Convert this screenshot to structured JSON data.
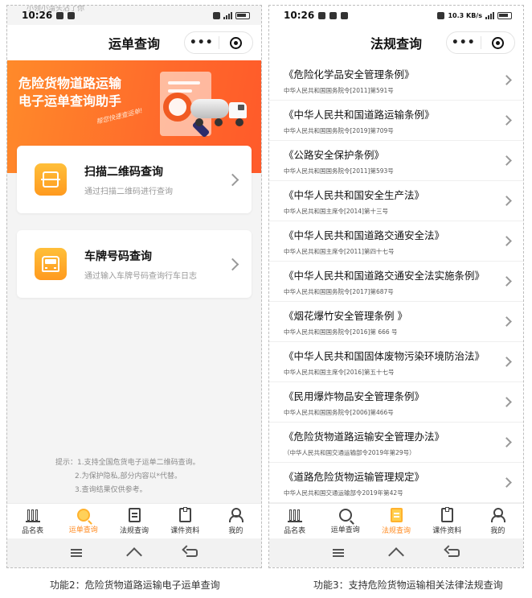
{
  "left_phone": {
    "overlay_hint": "小领小溜头沾了你",
    "status": {
      "time": "10:26"
    },
    "nav": {
      "title": "运单查询",
      "more": "•••"
    },
    "banner": {
      "title_line1": "危险货物道路运输",
      "title_line2": "电子运单查询助手",
      "slogan": "帮您快速查运单!"
    },
    "cards": [
      {
        "title": "扫描二维码查询",
        "subtitle": "通过扫描二维码进行查询",
        "icon": "scan-icon"
      },
      {
        "title": "车牌号码查询",
        "subtitle": "通过输入车牌号码查询行车日志",
        "icon": "bus-icon"
      }
    ],
    "tips": [
      "提示：1.支持全国危货电子运单二维码查询。",
      "2.为保护隐私,部分内容以*代替。",
      "3.查询结果仅供参考。"
    ],
    "tabs": [
      {
        "label": "品名表",
        "active": false
      },
      {
        "label": "运单查询",
        "active": true
      },
      {
        "label": "法规查询",
        "active": false
      },
      {
        "label": "课件资料",
        "active": false
      },
      {
        "label": "我的",
        "active": false
      }
    ]
  },
  "right_phone": {
    "status": {
      "time": "10:26",
      "speed": "10.3 KB/s"
    },
    "nav": {
      "title": "法规查询",
      "more": "•••"
    },
    "laws": [
      {
        "title": "《危险化学品安全管理条例》",
        "subtitle": "中华人民共和国国务院令[2011]第591号"
      },
      {
        "title": "《中华人民共和国道路运输条例》",
        "subtitle": "中华人民共和国国务院令[2019]第709号"
      },
      {
        "title": "《公路安全保护条例》",
        "subtitle": "中华人民共和国国务院令[2011]第593号"
      },
      {
        "title": "《中华人民共和国安全生产法》",
        "subtitle": "中华人民共和国主席令[2014]第十三号"
      },
      {
        "title": "《中华人民共和国道路交通安全法》",
        "subtitle": "中华人民共和国主席令[2011]第四十七号"
      },
      {
        "title": "《中华人民共和国道路交通安全法实施条例》",
        "subtitle": "中华人民共和国国务院令[2017]第687号"
      },
      {
        "title": "《烟花爆竹安全管理条例 》",
        "subtitle": "中华人民共和国国务院令[2016]第 666 号"
      },
      {
        "title": "《中华人民共和国固体废物污染环境防治法》",
        "subtitle": "中华人民共和国主席令[2016]第五十七号"
      },
      {
        "title": "《民用爆炸物品安全管理条例》",
        "subtitle": "中华人民共和国国务院令[2006]第466号"
      },
      {
        "title": "《危险货物道路运输安全管理办法》",
        "subtitle": "（中华人民共和国交通运输部令2019年第29号）"
      },
      {
        "title": "《道路危险货物运输管理规定》",
        "subtitle": "中华人民共和国交通运输部令2019年第42号"
      }
    ],
    "tabs": [
      {
        "label": "品名表",
        "active": false
      },
      {
        "label": "运单查询",
        "active": false
      },
      {
        "label": "法规查询",
        "active": true
      },
      {
        "label": "课件资料",
        "active": false
      },
      {
        "label": "我的",
        "active": false
      }
    ]
  },
  "captions": {
    "left": "功能2：危险货物道路运输电子运单查询",
    "right": "功能3：支持危险货物运输相关法律法规查询"
  },
  "colors": {
    "accent": "#ff8a1f",
    "banner": "#ff6a2b"
  }
}
